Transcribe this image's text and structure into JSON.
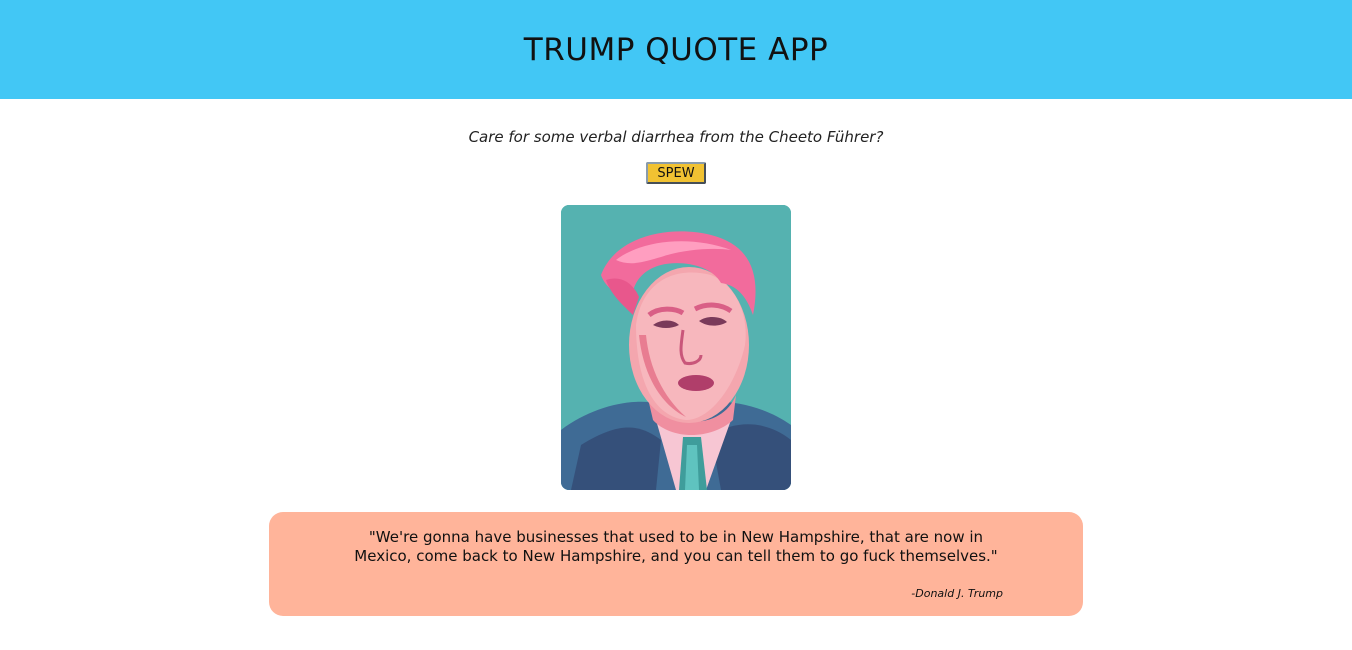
{
  "header": {
    "title": "TRUMP QUOTE APP"
  },
  "prompt": {
    "tagline": "Care for some verbal diarrhea from the Cheeto Führer?"
  },
  "actions": {
    "spew_label": "SPEW"
  },
  "portrait": {
    "icon": "portrait-image"
  },
  "quote": {
    "text": "\"We're gonna have businesses that used to be in New Hampshire, that are now in Mexico, come back to New Hampshire, and you can tell them to go fuck themselves.\"",
    "author": "-Donald J. Trump"
  },
  "colors": {
    "header_bg": "#42c7f5",
    "button_bg": "#f1c232",
    "quote_bg": "#ffb49a",
    "portrait_bg": "#55b2b0"
  }
}
